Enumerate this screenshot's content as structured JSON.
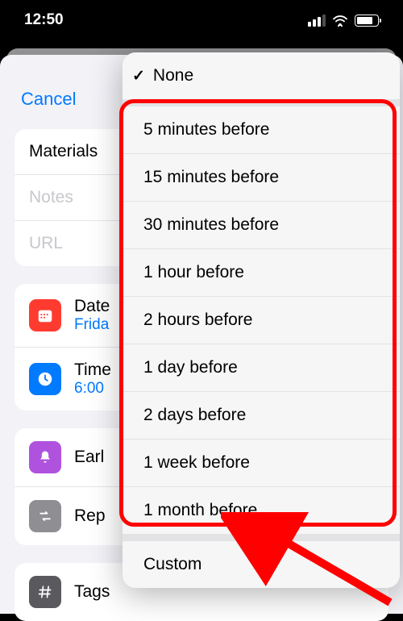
{
  "status": {
    "time": "12:50"
  },
  "header": {
    "cancel": "Cancel"
  },
  "fields": {
    "materials": "Materials",
    "notes": "Notes",
    "url": "URL",
    "date": "Date",
    "date_value": "Frida",
    "time": "Time",
    "time_value": "6:00",
    "early": "Earl",
    "repeat": "Rep",
    "tags": "Tags"
  },
  "popover": {
    "none": "None",
    "options": [
      "5 minutes before",
      "15 minutes before",
      "30 minutes before",
      "1 hour before",
      "2 hours before",
      "1 day before",
      "2 days before",
      "1 week before",
      "1 month before"
    ],
    "custom": "Custom"
  }
}
